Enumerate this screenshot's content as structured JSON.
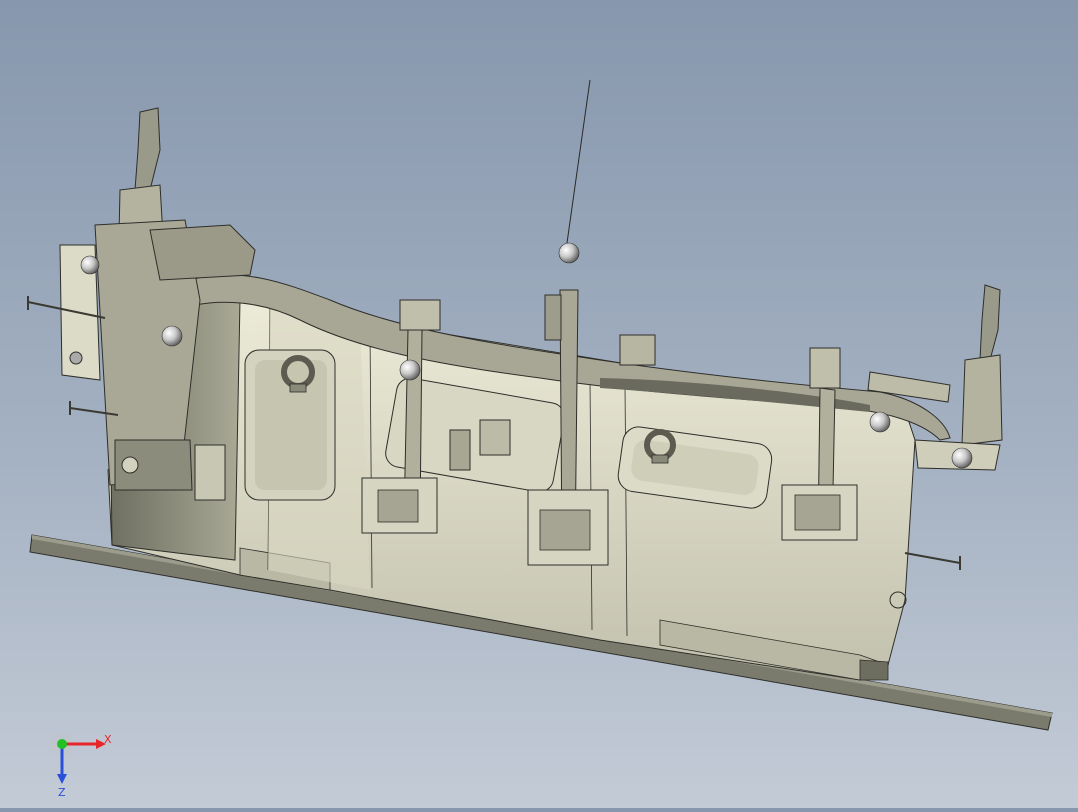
{
  "window": {
    "title": ""
  },
  "triad": {
    "x_label": "X",
    "z_label": "Z",
    "x_color": "#e8262a",
    "y_color": "#22c022",
    "z_color": "#2a4fd8"
  },
  "model": {
    "fill_light": "#e6e6d2",
    "fill_mid": "#c9c9b4",
    "fill_dark": "#8a8a7a",
    "edge": "#2e2e2a",
    "base_plate": "#77776a"
  }
}
